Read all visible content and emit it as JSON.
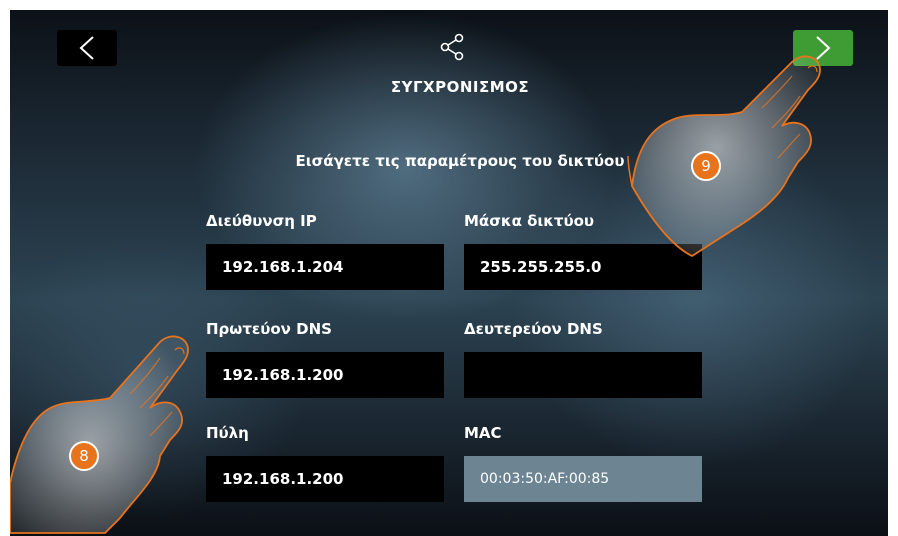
{
  "header": {
    "title": "ΣΥΓΧΡΟΝΙΣΜΟΣ",
    "back_icon": "chevron-left-icon",
    "next_icon": "chevron-right-icon",
    "share_icon": "share-icon"
  },
  "instruction": "Εισάγετε τις παραμέτρους του δικτύου",
  "fields": {
    "ip": {
      "label": "Διεύθυνση IP",
      "value": "192.168.1.204"
    },
    "mask": {
      "label": "Μάσκα δικτύου",
      "value": "255.255.255.0"
    },
    "dns1": {
      "label": "Πρωτεύον DNS",
      "value": "192.168.1.200"
    },
    "dns2": {
      "label": "Δευτερεύον DNS",
      "value": ""
    },
    "gateway": {
      "label": "Πύλη",
      "value": "192.168.1.200"
    },
    "mac": {
      "label": "MAC",
      "value": "00:03:50:AF:00:85"
    }
  },
  "callouts": {
    "step_8": "8",
    "step_9": "9"
  },
  "colors": {
    "next_button": "#3f9c35",
    "badge": "#e8731d",
    "mac_field": "#6d8593",
    "field": "#000000"
  }
}
